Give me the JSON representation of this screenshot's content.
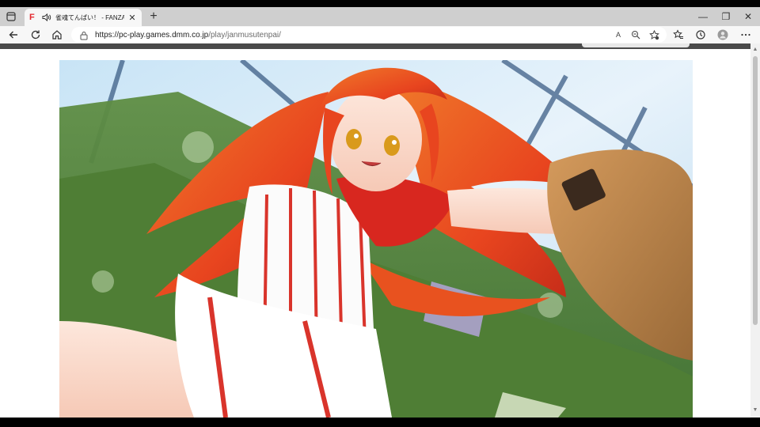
{
  "browser": {
    "tab": {
      "favicon_letter": "F",
      "title": "雀魂てんぱい！ - FANZA GAMES",
      "close_glyph": "✕"
    },
    "new_tab_glyph": "+",
    "window_controls": {
      "minimize": "—",
      "restore": "❐",
      "close": "✕"
    },
    "address": {
      "url_main": "https://pc-play.games.dmm.co.jp",
      "url_path": "/play/janmusutenpai/",
      "read_aloud_label": "A"
    }
  },
  "colors": {
    "accent_favicon": "#e3262c",
    "titlebar": "#cfcfcf",
    "toolbar": "#f7f7f7"
  },
  "icons": [
    "tab-actions-icon",
    "audio-icon",
    "back-icon",
    "refresh-icon",
    "home-icon",
    "lock-icon",
    "read-aloud-icon",
    "zoom-icon",
    "favorite-add-icon",
    "favorites-icon",
    "history-icon",
    "profile-icon",
    "more-icon"
  ]
}
